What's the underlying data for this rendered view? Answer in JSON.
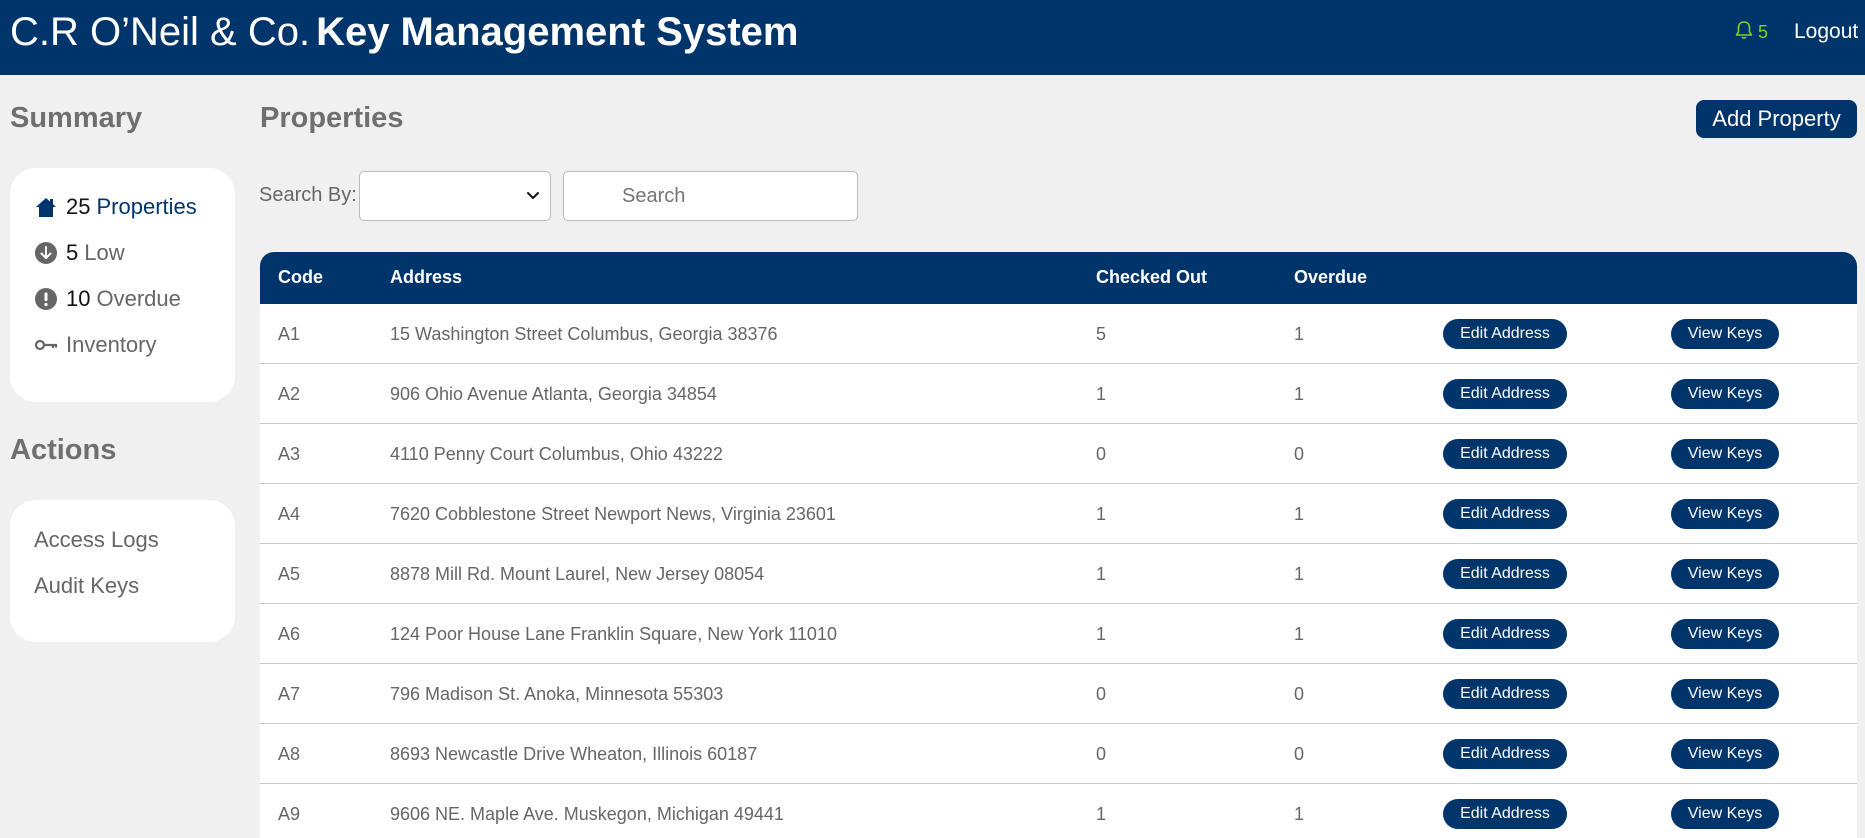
{
  "header": {
    "brand_light": "C.R O’Neil & Co.",
    "brand_bold": "Key Management System",
    "notification_count": "5",
    "logout_label": "Logout"
  },
  "summary": {
    "title": "Summary",
    "properties_count": "25",
    "properties_label": "Properties",
    "low_count": "5",
    "low_label": "Low",
    "overdue_count": "10",
    "overdue_label": "Overdue",
    "inventory_label": "Inventory"
  },
  "actions": {
    "title": "Actions",
    "access_logs_label": "Access Logs",
    "audit_keys_label": "Audit Keys"
  },
  "main": {
    "title": "Properties",
    "add_label": "Add Property",
    "search_by_label": "Search By:",
    "search_placeholder": "Search",
    "select_value": ""
  },
  "table": {
    "headers": {
      "code": "Code",
      "address": "Address",
      "checked_out": "Checked Out",
      "overdue": "Overdue"
    },
    "edit_label": "Edit Address",
    "view_label": "View Keys",
    "rows": [
      {
        "code": "A1",
        "address": "15 Washington Street Columbus, Georgia 38376",
        "checked_out": "5",
        "overdue": "1"
      },
      {
        "code": "A2",
        "address": "906 Ohio Avenue Atlanta, Georgia 34854",
        "checked_out": "1",
        "overdue": "1"
      },
      {
        "code": "A3",
        "address": "4110 Penny Court Columbus, Ohio 43222",
        "checked_out": "0",
        "overdue": "0"
      },
      {
        "code": "A4",
        "address": "7620 Cobblestone Street Newport News, Virginia 23601",
        "checked_out": "1",
        "overdue": "1"
      },
      {
        "code": "A5",
        "address": "8878 Mill Rd. Mount Laurel, New Jersey 08054",
        "checked_out": "1",
        "overdue": "1"
      },
      {
        "code": "A6",
        "address": "124 Poor House Lane Franklin Square, New York 11010",
        "checked_out": "1",
        "overdue": "1"
      },
      {
        "code": "A7",
        "address": "796 Madison St. Anoka, Minnesota 55303",
        "checked_out": "0",
        "overdue": "0"
      },
      {
        "code": "A8",
        "address": "8693 Newcastle Drive Wheaton, Illinois 60187",
        "checked_out": "0",
        "overdue": "0"
      },
      {
        "code": "A9",
        "address": "9606 NE. Maple Ave. Muskegon, Michigan 49441",
        "checked_out": "1",
        "overdue": "1"
      }
    ]
  },
  "icons": {
    "notification": "bell-icon",
    "properties": "house-icon",
    "low": "arrow-down-circle-icon",
    "overdue": "exclamation-circle-icon",
    "inventory": "key-icon"
  },
  "colors": {
    "brand": "#00356b",
    "notification": "#7ed321",
    "background": "#f0f0f0"
  }
}
